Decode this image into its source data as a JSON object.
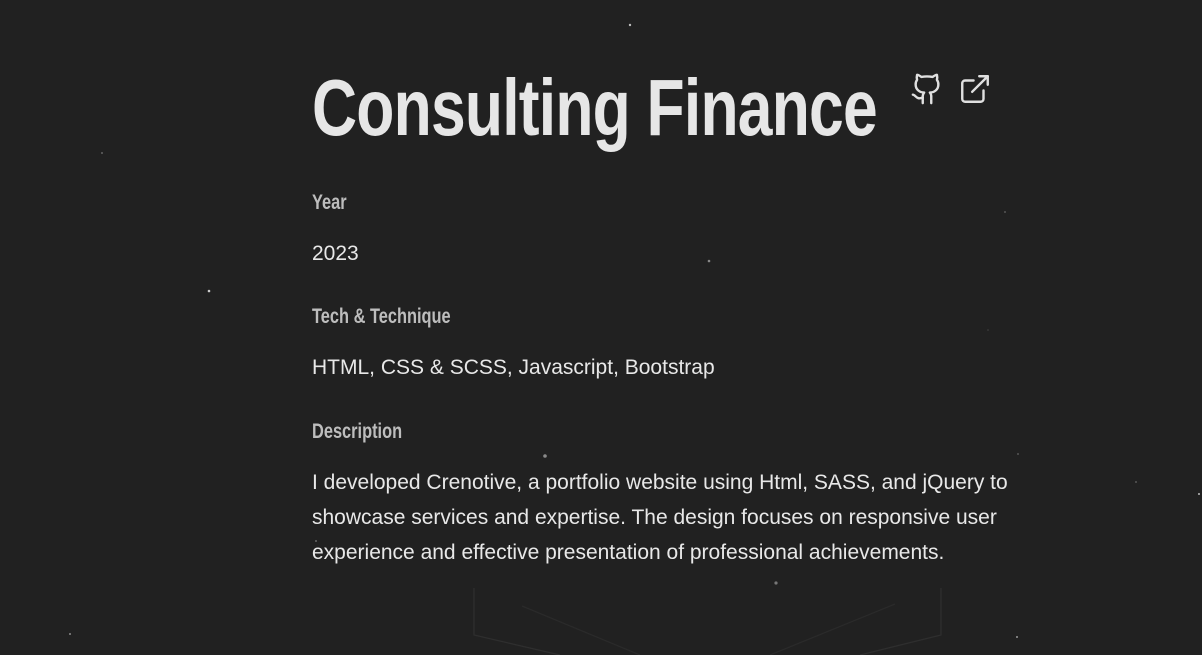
{
  "project": {
    "title": "Consulting Finance",
    "links": [
      {
        "icon": "github-icon",
        "name": "github-link"
      },
      {
        "icon": "external-link-icon",
        "name": "external-link"
      }
    ]
  },
  "details": {
    "year_label": "Year",
    "year_value": "2023",
    "tech_label": "Tech & Technique",
    "tech_value": "HTML, CSS & SCSS, Javascript, Bootstrap",
    "description_label": "Description",
    "description_value": "I developed Crenotive, a portfolio website using Html, SASS, and jQuery to showcase services and expertise. The design focuses on responsive user experience and effective presentation of professional achievements."
  },
  "colors": {
    "background": "#212121",
    "title": "#e6e6e6",
    "label": "#bdbdbd",
    "text": "#e8e8e8"
  }
}
